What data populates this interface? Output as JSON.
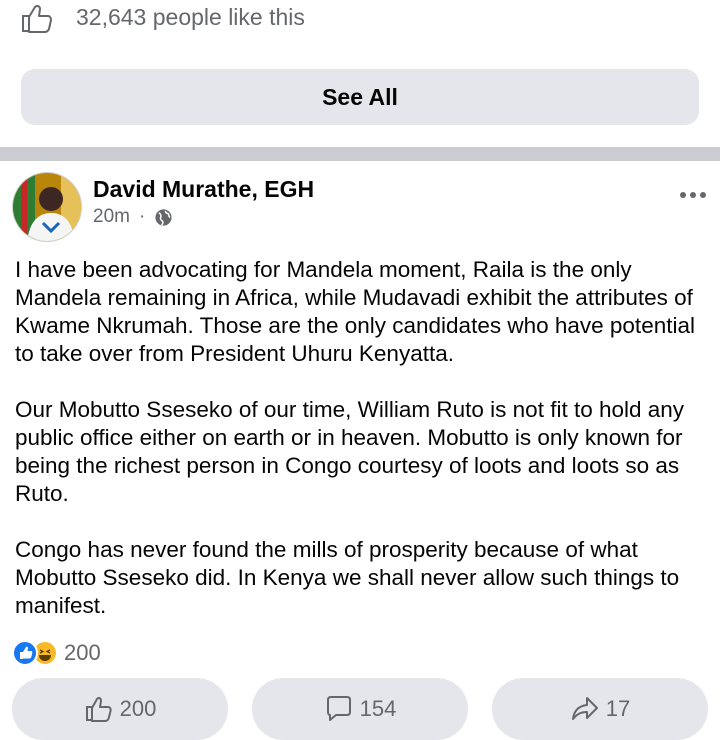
{
  "page_likes": {
    "text": "32,643 people like this"
  },
  "see_all": {
    "label": "See All"
  },
  "post": {
    "author": "David Murathe, EGH",
    "time": "20m",
    "separator": "·",
    "paragraphs": [
      "I have been advocating for Mandela moment, Raila is the only Mandela remaining in Africa, while Mudavadi exhibit the attributes of Kwame Nkrumah. Those are the only candidates who have potential to take over from President Uhuru Kenyatta.",
      "Our Mobutto Sseseko of our time, William Ruto is not fit to hold any public office either on earth or in heaven. Mobutto is only known for being the richest person in Congo courtesy of loots and loots so as Ruto.",
      "Congo has never found the mills of prosperity because of what Mobutto Sseseko did. In Kenya we shall never allow such things to manifest."
    ],
    "reaction_count": "200",
    "actions": {
      "like": "200",
      "comment": "154",
      "share": "17"
    }
  },
  "colors": {
    "accent": "#1877f2",
    "secondary_text": "#65676b",
    "button_bg": "#e4e6eb"
  }
}
